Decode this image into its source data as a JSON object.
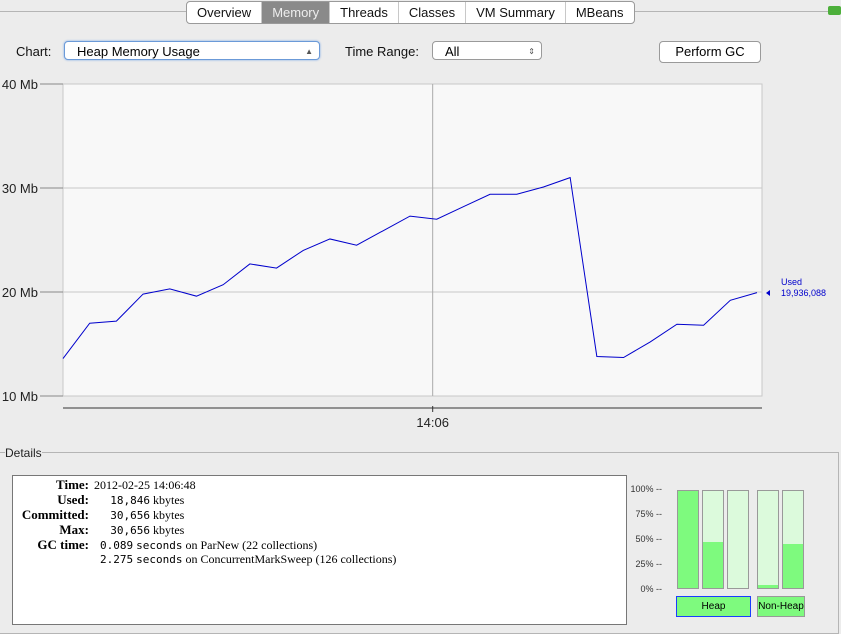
{
  "tabs": [
    "Overview",
    "Memory",
    "Threads",
    "Classes",
    "VM Summary",
    "MBeans"
  ],
  "active_tab": "Memory",
  "controls": {
    "chart_label": "Chart:",
    "chart_value": "Heap Memory Usage",
    "time_range_label": "Time Range:",
    "time_range_value": "All",
    "perform_gc": "Perform GC"
  },
  "chart_data": {
    "type": "line",
    "ylim": [
      10,
      40
    ],
    "yticks": [
      "10 Mb",
      "20 Mb",
      "30 Mb",
      "40 Mb"
    ],
    "ytick_values": [
      10,
      20,
      30,
      40
    ],
    "xtick_labels": [
      "14:06"
    ],
    "xtick_positions": [
      13.85
    ],
    "series": [
      {
        "name": "Used",
        "color": "#0000cc",
        "values": [
          13.6,
          17.0,
          17.2,
          19.8,
          20.3,
          19.6,
          20.7,
          22.7,
          22.3,
          24.0,
          25.1,
          24.5,
          25.9,
          27.3,
          27.0,
          28.2,
          29.4,
          29.4,
          30.1,
          31.0,
          13.8,
          13.7,
          15.2,
          16.9,
          16.8,
          19.2,
          19.94
        ]
      }
    ],
    "end_label": "Used",
    "end_value": "19,936,088",
    "grid": true
  },
  "details": {
    "legend": "Details",
    "time_label": "Time:",
    "time": "2012-02-25 14:06:48",
    "used_label": "Used:",
    "used": "18,846",
    "used_unit": "kbytes",
    "committed_label": "Committed:",
    "committed": "30,656",
    "committed_unit": "kbytes",
    "max_label": "Max:",
    "max": "30,656",
    "max_unit": "kbytes",
    "gc_label": "GC time:",
    "gc": [
      {
        "seconds": "0.089",
        "unit": "seconds",
        "desc": "on ParNew (22 collections)"
      },
      {
        "seconds": "2.275",
        "unit": "seconds",
        "desc": "on ConcurrentMarkSweep (126 collections)"
      }
    ]
  },
  "pools": {
    "ylabels": [
      "100% --",
      "75% --",
      "50% --",
      "25% --",
      "0% --"
    ],
    "bars_percent": [
      100,
      47,
      0,
      3,
      45
    ],
    "heap_label": "Heap",
    "nonheap_label": "Non-Heap"
  }
}
